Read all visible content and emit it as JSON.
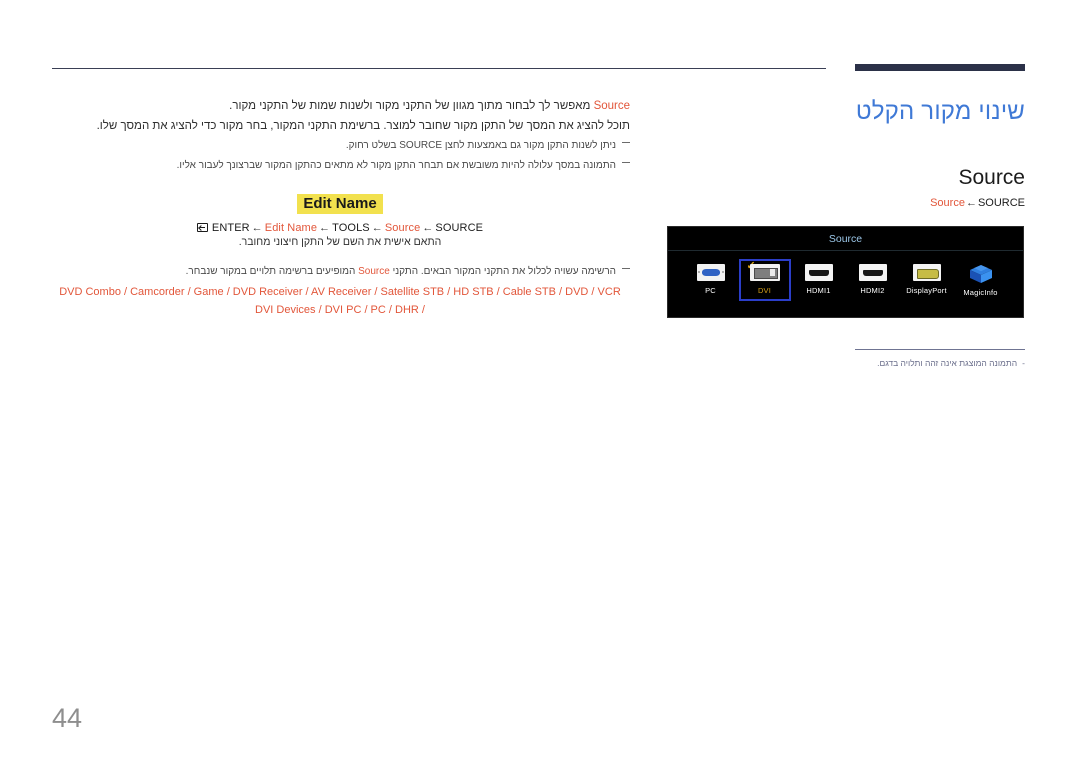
{
  "header": {
    "page_title": "שינוי מקור הקלט",
    "section_title": "Source",
    "breadcrumb_accent": "Source",
    "breadcrumb_arrow": "←",
    "breadcrumb_root": "SOURCE"
  },
  "body": {
    "para1_accent": "Source",
    "para1_text": " מאפשר לך לבחור מתוך מגוון של התקני מקור ולשנות שמות של התקני מקור.",
    "para2_text": "תוכל להציג את המסך של התקן מקור שחובר למוצר. ברשימת התקני המקור, בחר מקור כדי להציג את המסך שלו.",
    "note1_text": "ניתן לשנות התקן מקור גם באמצעות לחצן SOURCE בשלט רחוק.",
    "note2_text": "התמונה במסך עלולה להיות משובשת אם תבחר התקן מקור לא מתאים כהתקן המקור שברצונך לעבור אליו.",
    "edit_name_label": "Edit Name",
    "navpath": {
      "enter_icon": "enter-icon",
      "enter_label": "ENTER",
      "arrow": "←",
      "edit_name": "Edit Name",
      "tools": "TOOLS",
      "source": "Source",
      "source_root": "SOURCE"
    },
    "subcaption": "התאם אישית את השם של התקן חיצוני מחובר.",
    "note3_prefix": "הרשימה עשויה לכלול את התקני המקור הבאים. התקני ",
    "note3_accent": "Source",
    "note3_suffix": " המופיעים ברשימה תלויים במקור שנבחר.",
    "device_list_line1": "DVD Combo / Camcorder / Game / DVD Receiver / AV Receiver / Satellite STB / HD STB / Cable STB / DVD / VCR",
    "device_list_line2": "DVI Devices / DVI PC / PC / DHR /"
  },
  "osd": {
    "title": "Source",
    "sources": [
      {
        "label": "PC",
        "icon": "vga-icon",
        "selected": false
      },
      {
        "label": "DVI",
        "icon": "dvi-icon",
        "selected": true
      },
      {
        "label": "HDMI1",
        "icon": "hdmi-icon",
        "selected": false
      },
      {
        "label": "HDMI2",
        "icon": "hdmi-icon",
        "selected": false
      },
      {
        "label": "DisplayPort",
        "icon": "displayport-icon",
        "selected": false
      },
      {
        "label": "MagicInfo",
        "icon": "magicinfo-cube-icon",
        "selected": false
      }
    ],
    "check_glyph": "✓",
    "footnote_dash": "-",
    "footnote": "התמונה המוצגת אינה זהה ותלויה בדגם."
  },
  "footer": {
    "page_number": "44"
  },
  "colors": {
    "title_blue": "#3f79d6",
    "accent_orange": "#e2563a",
    "highlight_yellow": "#f2e14e",
    "osd_select_blue": "#2b3ec9",
    "osd_select_gold": "#d8a21a",
    "osd_title_cyan": "#9cc7e8",
    "rule_navy": "#2b3148",
    "page_num_gray": "#8e8e8e"
  }
}
